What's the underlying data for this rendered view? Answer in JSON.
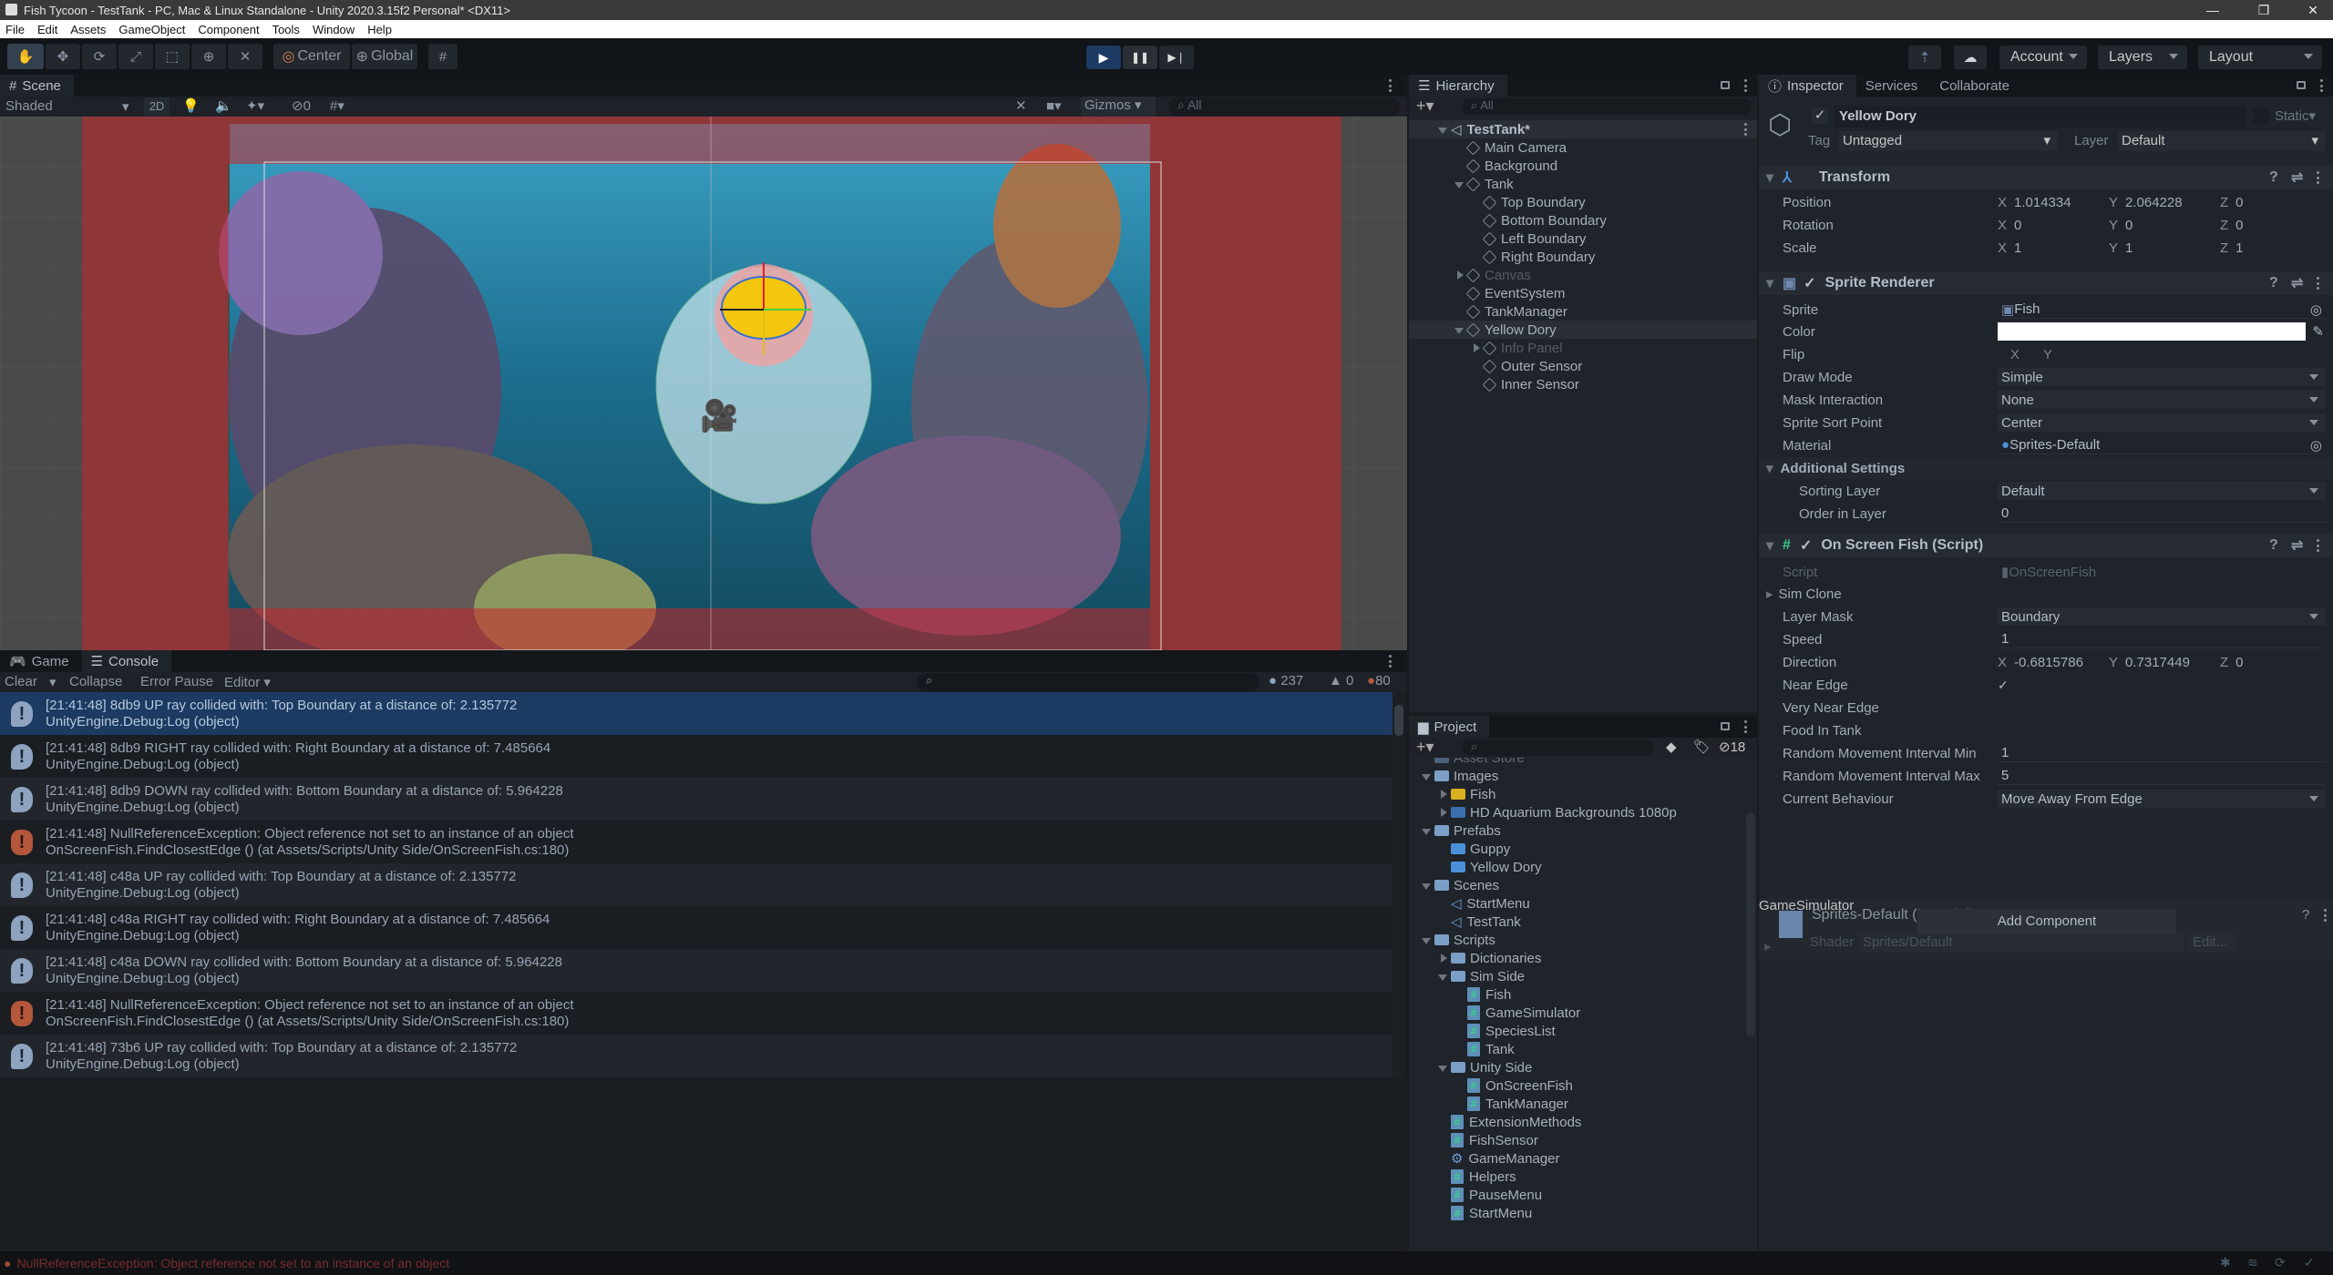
{
  "window": {
    "title": "Fish Tycoon - TestTank - PC, Mac & Linux Standalone - Unity 2020.3.15f2 Personal* <DX11>",
    "controls": [
      "minimize",
      "restore",
      "close"
    ]
  },
  "menu": [
    "File",
    "Edit",
    "Assets",
    "GameObject",
    "Component",
    "Tools",
    "Window",
    "Help"
  ],
  "toolbar": {
    "tools": [
      {
        "name": "hand-tool",
        "glyph": "✋"
      },
      {
        "name": "move-tool",
        "glyph": "✥"
      },
      {
        "name": "rotate-tool",
        "glyph": "⟳"
      },
      {
        "name": "scale-tool",
        "glyph": "⤢"
      },
      {
        "name": "rect-tool",
        "glyph": "⬚"
      },
      {
        "name": "transform-tool",
        "glyph": "⊕"
      },
      {
        "name": "custom-tool",
        "glyph": "✕"
      }
    ],
    "pivot": "Center",
    "space": "Global",
    "play": "▶",
    "pause": "❚❚",
    "step": "▶❘",
    "account": "Account",
    "layers": "Layers",
    "layout": "Layout"
  },
  "scene": {
    "tab": "Scene",
    "shading": "Shaded",
    "mode_2d": "2D",
    "hidden_count": "0",
    "gizmos": "Gizmos",
    "search_placeholder": "All"
  },
  "console": {
    "tabs": [
      "Game",
      "Console"
    ],
    "buttons": {
      "clear": "Clear",
      "collapse": "Collapse",
      "error_pause": "Error Pause",
      "editor": "Editor"
    },
    "counts": {
      "log": "237",
      "warning": "0",
      "error": "80"
    },
    "entries": [
      {
        "type": "log",
        "line1": "[21:41:48] 8db9 UP ray collided with: Top Boundary at a distance of: 2.135772",
        "line2": "UnityEngine.Debug:Log (object)",
        "selected": true
      },
      {
        "type": "log",
        "line1": "[21:41:48] 8db9 RIGHT ray collided with: Right Boundary at a distance of: 7.485664",
        "line2": "UnityEngine.Debug:Log (object)"
      },
      {
        "type": "log",
        "line1": "[21:41:48] 8db9 DOWN ray collided with: Bottom Boundary at a distance of: 5.964228",
        "line2": "UnityEngine.Debug:Log (object)"
      },
      {
        "type": "error",
        "line1": "[21:41:48] NullReferenceException: Object reference not set to an instance of an object",
        "line2": "OnScreenFish.FindClosestEdge () (at Assets/Scripts/Unity Side/OnScreenFish.cs:180)"
      },
      {
        "type": "log",
        "line1": "[21:41:48] c48a UP ray collided with: Top Boundary at a distance of: 2.135772",
        "line2": "UnityEngine.Debug:Log (object)"
      },
      {
        "type": "log",
        "line1": "[21:41:48] c48a RIGHT ray collided with: Right Boundary at a distance of: 7.485664",
        "line2": "UnityEngine.Debug:Log (object)"
      },
      {
        "type": "log",
        "line1": "[21:41:48] c48a DOWN ray collided with: Bottom Boundary at a distance of: 5.964228",
        "line2": "UnityEngine.Debug:Log (object)"
      },
      {
        "type": "error",
        "line1": "[21:41:48] NullReferenceException: Object reference not set to an instance of an object",
        "line2": "OnScreenFish.FindClosestEdge () (at Assets/Scripts/Unity Side/OnScreenFish.cs:180)"
      },
      {
        "type": "log",
        "line1": "[21:41:48] 73b6 UP ray collided with: Top Boundary at a distance of: 2.135772",
        "line2": "UnityEngine.Debug:Log (object)"
      }
    ]
  },
  "hierarchy": {
    "tab": "Hierarchy",
    "search_placeholder": "All",
    "items": [
      {
        "label": "TestTank*",
        "depth": 0,
        "expanded": true,
        "scene": true
      },
      {
        "label": "Main Camera",
        "depth": 1
      },
      {
        "label": "Background",
        "depth": 1
      },
      {
        "label": "Tank",
        "depth": 1,
        "expanded": true
      },
      {
        "label": "Top Boundary",
        "depth": 2
      },
      {
        "label": "Bottom Boundary",
        "depth": 2
      },
      {
        "label": "Left Boundary",
        "depth": 2
      },
      {
        "label": "Right Boundary",
        "depth": 2
      },
      {
        "label": "Canvas",
        "depth": 1,
        "collapsed": true,
        "inactive": true
      },
      {
        "label": "EventSystem",
        "depth": 1
      },
      {
        "label": "TankManager",
        "depth": 1
      },
      {
        "label": "Yellow Dory",
        "depth": 1,
        "expanded": true,
        "selected": true
      },
      {
        "label": "Info Panel",
        "depth": 2,
        "collapsed": true,
        "inactive": true
      },
      {
        "label": "Outer Sensor",
        "depth": 2
      },
      {
        "label": "Inner Sensor",
        "depth": 2
      }
    ]
  },
  "project": {
    "tab": "Project",
    "hidden_count": "18",
    "items": [
      {
        "label": "Asset Store",
        "depth": 0,
        "kind": "folder",
        "clipped": true
      },
      {
        "label": "Images",
        "depth": 0,
        "kind": "folder",
        "expanded": true
      },
      {
        "label": "Fish",
        "depth": 1,
        "kind": "sprite",
        "collapsed": true
      },
      {
        "label": "HD Aquarium Backgrounds 1080p",
        "depth": 1,
        "kind": "sprite",
        "collapsed": true
      },
      {
        "label": "Prefabs",
        "depth": 0,
        "kind": "folder",
        "expanded": true
      },
      {
        "label": "Guppy",
        "depth": 1,
        "kind": "prefab"
      },
      {
        "label": "Yellow Dory",
        "depth": 1,
        "kind": "prefab"
      },
      {
        "label": "Scenes",
        "depth": 0,
        "kind": "folder",
        "expanded": true
      },
      {
        "label": "StartMenu",
        "depth": 1,
        "kind": "scene"
      },
      {
        "label": "TestTank",
        "depth": 1,
        "kind": "scene"
      },
      {
        "label": "Scripts",
        "depth": 0,
        "kind": "folder",
        "expanded": true
      },
      {
        "label": "Dictionaries",
        "depth": 1,
        "kind": "folder",
        "collapsed": true
      },
      {
        "label": "Sim Side",
        "depth": 1,
        "kind": "folder",
        "expanded": true
      },
      {
        "label": "Fish",
        "depth": 2,
        "kind": "script"
      },
      {
        "label": "GameSimulator",
        "depth": 2,
        "kind": "script"
      },
      {
        "label": "SpeciesList",
        "depth": 2,
        "kind": "script"
      },
      {
        "label": "Tank",
        "depth": 2,
        "kind": "script"
      },
      {
        "label": "Unity Side",
        "depth": 1,
        "kind": "folder",
        "expanded": true
      },
      {
        "label": "OnScreenFish",
        "depth": 2,
        "kind": "script"
      },
      {
        "label": "TankManager",
        "depth": 2,
        "kind": "script"
      },
      {
        "label": "ExtensionMethods",
        "depth": 1,
        "kind": "script"
      },
      {
        "label": "FishSensor",
        "depth": 1,
        "kind": "script"
      },
      {
        "label": "GameManager",
        "depth": 1,
        "kind": "gear"
      },
      {
        "label": "Helpers",
        "depth": 1,
        "kind": "script"
      },
      {
        "label": "PauseMenu",
        "depth": 1,
        "kind": "script"
      },
      {
        "label": "StartMenu",
        "depth": 1,
        "kind": "script"
      }
    ]
  },
  "inspector": {
    "tabs": [
      "Inspector",
      "Services",
      "Collaborate"
    ],
    "object_name": "Yellow Dory",
    "static_label": "Static",
    "tag_label": "Tag",
    "tag": "Untagged",
    "layer_label": "Layer",
    "layer": "Default",
    "transform": {
      "title": "Transform",
      "position": {
        "label": "Position",
        "x": "1.014334",
        "y": "2.064228",
        "z": "0"
      },
      "rotation": {
        "label": "Rotation",
        "x": "0",
        "y": "0",
        "z": "0"
      },
      "scale": {
        "label": "Scale",
        "x": "1",
        "y": "1",
        "z": "1"
      }
    },
    "sprite_renderer": {
      "title": "Sprite Renderer",
      "sprite_label": "Sprite",
      "sprite": "Fish",
      "color_label": "Color",
      "color": "#ffffff",
      "flip_label": "Flip",
      "flip_x": "X",
      "flip_y": "Y",
      "draw_mode_label": "Draw Mode",
      "draw_mode": "Simple",
      "mask_label": "Mask Interaction",
      "mask": "None",
      "sort_point_label": "Sprite Sort Point",
      "sort_point": "Center",
      "material_label": "Material",
      "material": "Sprites-Default",
      "additional_settings": "Additional Settings",
      "sorting_layer_label": "Sorting Layer",
      "sorting_layer": "Default",
      "order_label": "Order in Layer",
      "order": "0"
    },
    "on_screen_fish": {
      "title": "On Screen Fish (Script)",
      "script_label": "Script",
      "script": "OnScreenFish",
      "sim_clone": "Sim Clone",
      "layer_mask_label": "Layer Mask",
      "layer_mask": "Boundary",
      "speed_label": "Speed",
      "speed": "1",
      "direction_label": "Direction",
      "dir_x": "-0.6815786",
      "dir_y": "0.7317449",
      "dir_z": "0",
      "near_edge_label": "Near Edge",
      "near_edge": true,
      "very_near_edge_label": "Very Near Edge",
      "very_near_edge": false,
      "food_label": "Food In Tank",
      "food": false,
      "rmin_label": "Random Movement Interval Min",
      "rmin": "1",
      "rmax_label": "Random Movement Interval Max",
      "rmax": "5",
      "behaviour_label": "Current Behaviour",
      "behaviour": "Move Away From Edge"
    },
    "material_preview": {
      "title": "Sprites-Default (Material)",
      "shader_label": "Shader",
      "shader": "Sprites/Default",
      "edit": "Edit..."
    },
    "add_component": "Add Component"
  },
  "statusbar": {
    "message": "NullReferenceException: Object reference not set to an instance of an object"
  }
}
